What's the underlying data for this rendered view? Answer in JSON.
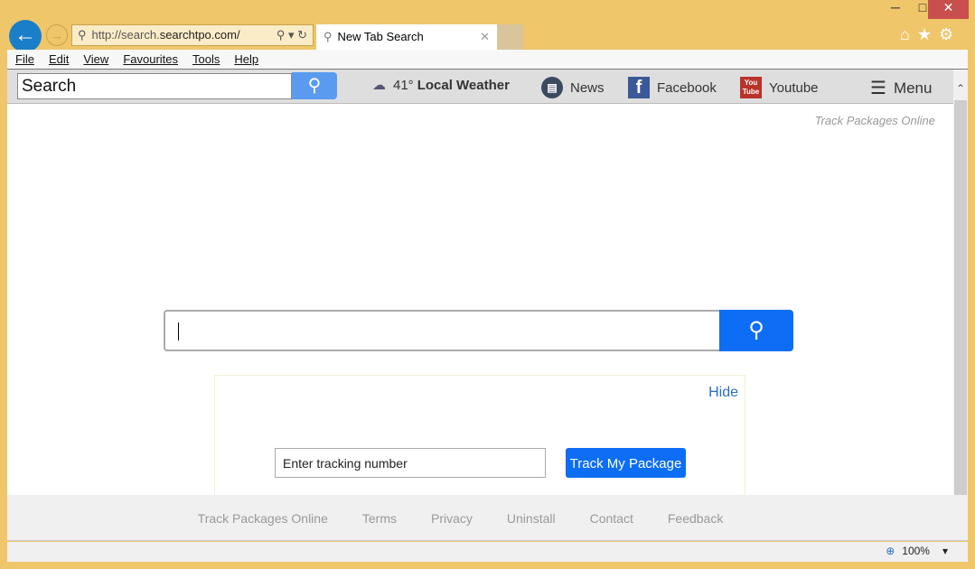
{
  "browser": {
    "url_prefix": "http://search.",
    "url_domain": "searchtpo.com/",
    "tab_title": "New Tab Search",
    "zoom": "100%"
  },
  "menu": [
    "File",
    "Edit",
    "View",
    "Favourites",
    "Tools",
    "Help"
  ],
  "toolbar": {
    "search_value": "Search",
    "weather": "41°",
    "weather_label": "Local Weather",
    "news": "News",
    "facebook": "Facebook",
    "youtube": "Youtube",
    "menu": "Menu"
  },
  "main": {
    "top_link": "Track Packages Online",
    "hide": "Hide",
    "tracking_placeholder": "Enter tracking number",
    "track_button": "Track My Package"
  },
  "footer": [
    "Track Packages Online",
    "Terms",
    "Privacy",
    "Uninstall",
    "Contact",
    "Feedback"
  ]
}
